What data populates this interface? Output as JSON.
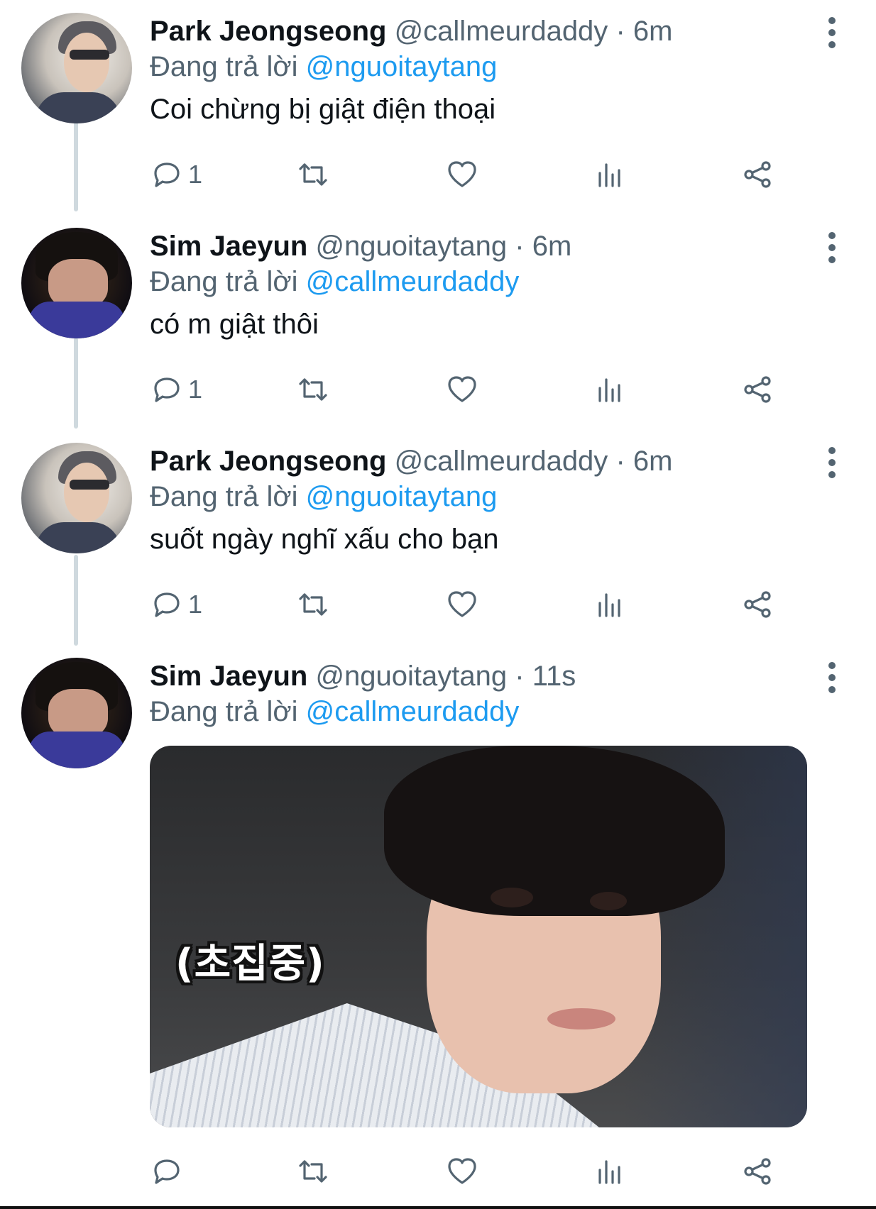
{
  "reply_prefix": "Đang trả lời",
  "tweets": [
    {
      "name": "Park Jeongseong",
      "handle": "@callmeurdaddy",
      "dot": "·",
      "time": "6m",
      "reply_to": "@nguoitaytang",
      "text": "Coi chừng bị giật điện thoại",
      "reply_count": "1",
      "avatar": "light"
    },
    {
      "name": "Sim Jaeyun",
      "handle": "@nguoitaytang",
      "dot": "·",
      "time": "6m",
      "reply_to": "@callmeurdaddy",
      "text": "có m giật thôi",
      "reply_count": "1",
      "avatar": "dark"
    },
    {
      "name": "Park Jeongseong",
      "handle": "@callmeurdaddy",
      "dot": "·",
      "time": "6m",
      "reply_to": "@nguoitaytang",
      "text": "suốt ngày nghĩ xấu cho bạn",
      "reply_count": "1",
      "avatar": "light"
    },
    {
      "name": "Sim Jaeyun",
      "handle": "@nguoitaytang",
      "dot": "·",
      "time": "11s",
      "reply_to": "@callmeurdaddy",
      "media_caption": "(초집중)",
      "avatar": "dark"
    }
  ],
  "icons": {
    "reply": "reply-icon",
    "retweet": "retweet-icon",
    "like": "heart-icon",
    "views": "analytics-icon",
    "share": "share-icon",
    "more": "more-vertical-icon"
  },
  "colors": {
    "text": "#0f1419",
    "secondary": "#536471",
    "accent": "#1d9bf0",
    "thread_line": "#cfd9de"
  }
}
